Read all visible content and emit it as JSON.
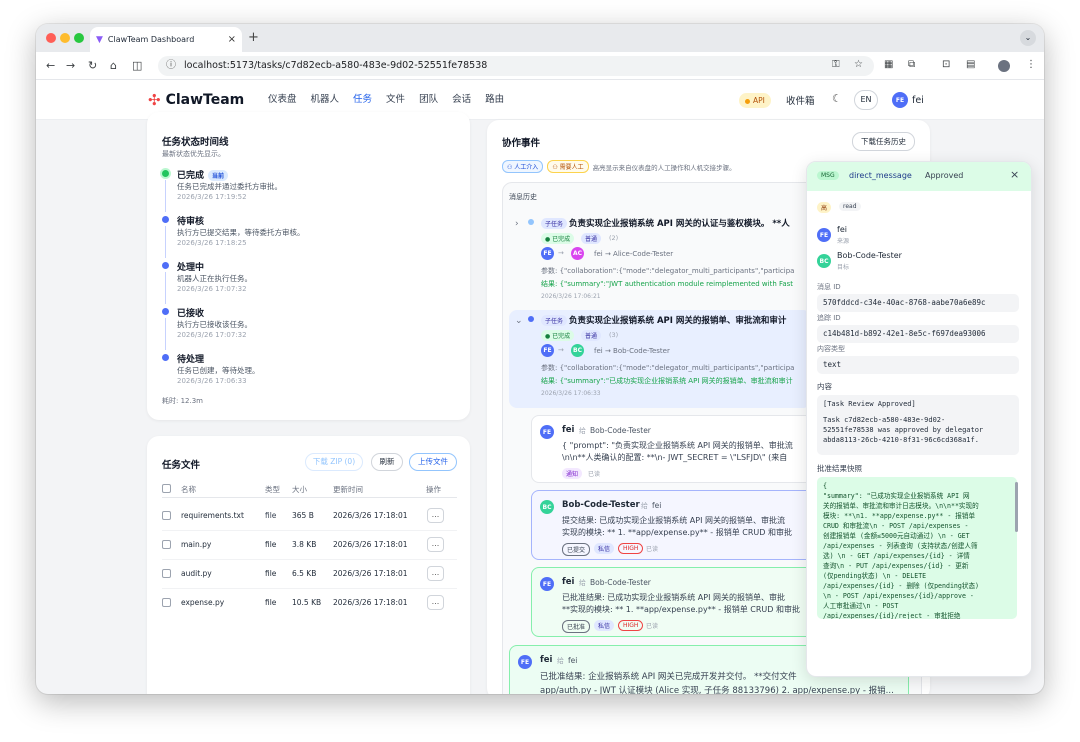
{
  "browser": {
    "tab_title": "ClawTeam Dashboard",
    "url": "localhost:5173/tasks/c7d82ecb-a580-483e-9d02-52551fe78538"
  },
  "nav": {
    "brand": "ClawTeam",
    "links": [
      "仪表盘",
      "机器人",
      "任务",
      "文件",
      "团队",
      "会话",
      "路由"
    ],
    "active": "任务",
    "api_label": "API",
    "inbox": "收件箱",
    "lang": "EN",
    "user_initials": "FE",
    "user_name": "fei"
  },
  "timeline": {
    "title": "任务状态时间线",
    "subtitle": "最新状态优先显示。",
    "current_badge": "当前",
    "items": [
      {
        "title": "已完成",
        "desc": "任务已完成并通过委托方审批。",
        "time": "2026/3/26 17:19:52"
      },
      {
        "title": "待审核",
        "desc": "执行方已提交结果，等待委托方审核。",
        "time": "2026/3/26 17:18:25"
      },
      {
        "title": "处理中",
        "desc": "机器人正在执行任务。",
        "time": "2026/3/26 17:07:32"
      },
      {
        "title": "已接收",
        "desc": "执行方已接收该任务。",
        "time": "2026/3/26 17:07:32"
      },
      {
        "title": "待处理",
        "desc": "任务已创建，等待处理。",
        "time": "2026/3/26 17:06:33"
      }
    ],
    "elapsed": "耗时: 12.3m"
  },
  "files": {
    "title": "任务文件",
    "download_zip": "下载 ZIP (0)",
    "refresh": "刷新",
    "upload": "上传文件",
    "columns": [
      "名称",
      "类型",
      "大小",
      "更新时间",
      "操作"
    ],
    "rows": [
      {
        "name": "requirements.txt",
        "type": "file",
        "size": "365 B",
        "updated": "2026/3/26 17:18:01"
      },
      {
        "name": "main.py",
        "type": "file",
        "size": "3.8 KB",
        "updated": "2026/3/26 17:18:01"
      },
      {
        "name": "audit.py",
        "type": "file",
        "size": "6.5 KB",
        "updated": "2026/3/26 17:18:01"
      },
      {
        "name": "expense.py",
        "type": "file",
        "size": "10.5 KB",
        "updated": "2026/3/26 17:18:01"
      }
    ],
    "action": "..."
  },
  "events": {
    "title": "协作事件",
    "download_history": "下载任务历史",
    "tag_human": "人工介入",
    "tag_needs_human": "需要人工",
    "tag_hint": "高亮显示来自仪表盘的人工操作和人机交接步骤。",
    "history_title": "消息历史",
    "subtasks": [
      {
        "expander": "›",
        "tag": "子任务",
        "title": "负责实现企业报销系统 API 网关的认证与鉴权模块。 **人",
        "status": "已完成",
        "priority": "普通",
        "count": "(2)",
        "from": "FE",
        "to": "AC",
        "route": "fei → Alice-Code-Tester",
        "params": "参数: {\"collaboration\":{\"mode\":\"delegator_multi_participants\",\"participa",
        "result": "结果: {\"summary\":\"JWT authentication module reimplemented with Fast",
        "time": "2026/3/26 17:06:21"
      },
      {
        "expander": "⌄",
        "tag": "子任务",
        "title": "负责实现企业报销系统 API 网关的报销单、审批流和审计",
        "status": "已完成",
        "priority": "普通",
        "count": "(3)",
        "from": "FE",
        "to": "BC",
        "route": "fei → Bob-Code-Tester",
        "params": "参数: {\"collaboration\":{\"mode\":\"delegator_multi_participants\",\"participa",
        "result": "结果: {\"summary\":\"已成功实现企业报销系统 API 网关的报销单、审批流和审计",
        "time": "2026/3/26 17:06:33"
      }
    ],
    "messages": [
      {
        "from": "fei",
        "initials": "FE",
        "arrow": "给",
        "to": "Bob-Code-Tester",
        "line1": "{ \"prompt\": \"负责实现企业报销系统 API 网关的报销单、审批流",
        "line2": "\\n\\n**人类确认的配置: **\\n- JWT_SECRET = \\\"LSFJD\\\" (来自",
        "tags": [
          "通知"
        ],
        "read": "已读"
      },
      {
        "from": "Bob-Code-Tester",
        "initials": "BC",
        "arrow": "给",
        "to": "fei",
        "line1": "提交结果: 已成功实现企业报销系统 API 网关的报销单、审批流",
        "line2": "实现的模块: ** 1. **app/expense.py** - 报销单 CRUD 和审批",
        "tags": [
          "已提交",
          "私信",
          "HIGH"
        ],
        "read": "已读"
      },
      {
        "from": "fei",
        "initials": "FE",
        "arrow": "给",
        "to": "Bob-Code-Tester",
        "line1": "已批准结果: 已成功实现企业报销系统 API 网关的报销单、审批",
        "line2": "**实现的模块: ** 1. **app/expense.py** - 报销单 CRUD 和审批",
        "tags": [
          "已批准",
          "私信",
          "HIGH"
        ],
        "read": "已读"
      },
      {
        "from": "fei",
        "initials": "FE",
        "arrow": "给",
        "to": "fei",
        "line1": "已批准结果: 企业报销系统 API 网关已完成开发并交付。 **交付文件",
        "line2": "app/auth.py - JWT 认证模块 (Alice 实现, 子任务 88133796) 2. app/expense.py - 报销...",
        "tags": [],
        "read": ""
      }
    ]
  },
  "detail": {
    "msg_tag": "MSG",
    "type": "direct_message",
    "status": "Approved",
    "close": "×",
    "priority": "高",
    "read": "read",
    "from_name": "fei",
    "from_initials": "FE",
    "from_role": "来源",
    "to_name": "Bob-Code-Tester",
    "to_initials": "BC",
    "to_role": "目标",
    "message_id_label": "消息 ID",
    "message_id": "570fddcd-c34e-40ac-8768-aabe70a6e89c",
    "trace_id_label": "追踪 ID",
    "trace_id": "c14b481d-b892-42e1-8e5c-f697dea93006",
    "content_type_label": "内容类型",
    "content_type": "text",
    "content_label": "内容",
    "content_lines": [
      "[Task Review Approved]",
      "",
      "Task c7d82ecb-a580-483e-9d02-",
      "52551fe78538 was approved by delegator",
      "abda8113-26cb-4210-8f31-96c6cd368a1f."
    ],
    "snapshot_label": "批准结果快照",
    "snapshot_lines": [
      "{",
      "  \"summary\": \"已成功实现企业报销系统 API 网",
      "关的报销单、审批流和审计日志模块。\\n\\n**实现的",
      "模块: **\\n1. **app/expense.py** - 报销单",
      "CRUD 和审批流\\n   - POST /api/expenses -",
      "创建报销单 (金额≤5000元自动通过) \\n   - GET",
      "/api/expenses - 列表查询 (支持状态/创建人筛",
      "选) \\n   - GET /api/expenses/{id} - 详情",
      "查询\\n   - PUT /api/expenses/{id} - 更新",
      "(仅pending状态) \\n   - DELETE",
      "/api/expenses/{id} - 删除 (仅pending状态)",
      "\\n   - POST /api/expenses/{id}/approve -",
      "人工审批通过\\n   - POST",
      "/api/expenses/{id}/reject - 审批拒绝"
    ]
  },
  "colors": {
    "accent": "#2563eb",
    "avatar_fe": "#4f6ef7",
    "avatar_ac": "#d946ef",
    "avatar_bc": "#34d399",
    "success": "#16a34a"
  }
}
